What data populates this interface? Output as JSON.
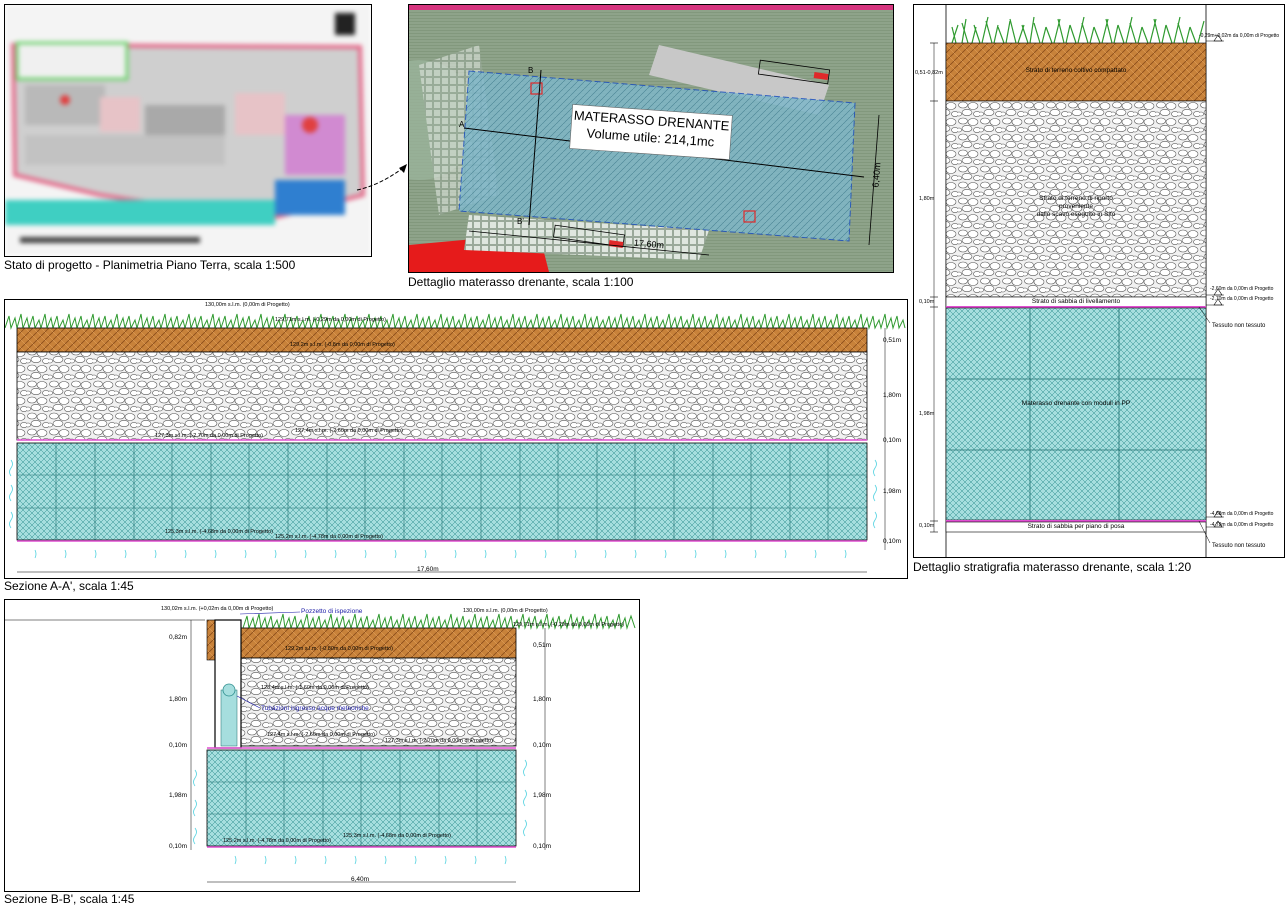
{
  "plan": {
    "caption": "Stato di progetto - Planimetria Piano Terra, scala 1:500"
  },
  "detail": {
    "caption": "Dettaglio materasso drenante, scala 1:100",
    "title_line1": "MATERASSO DRENANTE",
    "title_line2": "Volume utile: 214,1mc",
    "marker_a": "A",
    "marker_b_top": "B",
    "marker_b_bottom": "B'",
    "dim_length": "17,60m",
    "dim_width": "6,40m"
  },
  "stratigraphy": {
    "caption": "Dettaglio stratigrafia materasso drenante, scala 1:20",
    "layers": {
      "topsoil": "Strato di terreno coltivo compattato",
      "fill_line1": "Strato di terreno di riporto",
      "fill_line2": "proveniente",
      "fill_line3": "dallo scavo eseguito in Sito",
      "sand_top": "Strato di sabbia di livellamento",
      "mattress": "Materasso drenante con moduli in PP",
      "sand_bottom": "Strato di sabbia per piano di posa"
    },
    "fabric_top": "Tessuto non tessuto",
    "fabric_bottom": "Tessuto non tessuto",
    "thickness": [
      "0,51-0,82m",
      "1,80m",
      "0,10m",
      "1,98m",
      "0,10m"
    ],
    "levels": [
      "-0,29m+0,02m da 0,00m di Progetto",
      "-2,60m da 0,00m di Progetto",
      "-2,70m da 0,00m di Progetto",
      "-4,68m da 0,00m di Progetto",
      "-4,78m da 0,00m di Progetto"
    ]
  },
  "section_aa": {
    "caption": "Sezione A-A', scala 1:45",
    "levels": {
      "ground": "130,00m s.l.m. (0,00m di Progetto)",
      "grass": "129,71m s.l.m. (-0,29m da 0,00m di Progetto)",
      "topsoil_base": "129,2m s.l.m. (-0,8m da 0,00m di Progetto)",
      "fill_base": "127,4m s.l.m. (-2,60m da 0,00m di Progetto)",
      "sand_base": "127,3m s.l.m. (-2,70m da 0,00m di Progetto)",
      "mattress_base": "125,3m s.l.m. (-4,68m da 0,00m di Progetto)",
      "bottom": "125,2m s.l.m. (-4,78m da 0,00m di Progetto)"
    },
    "thickness": [
      "0,51m",
      "1,80m",
      "0,10m",
      "1,98m",
      "0,10m"
    ],
    "dim_length": "17,60m"
  },
  "section_bb": {
    "caption": "Sezione B-B', scala 1:45",
    "inspection_well": "Pozzetto di ispezione",
    "inlet_pipe": "Tubazioni ingresso acque meteoriche",
    "levels": {
      "well_top": "130,02m s.l.m. (+0,02m da 0,00m di Progetto)",
      "ground": "130,00m s.l.m. (0,00m di Progetto)",
      "grass": "129,71m s.l.m. (-0,29m da 0,00m di Progetto)",
      "topsoil_base": "129,2m s.l.m. (-0,80m da 0,00m di Progetto)",
      "pipe": "128,4m s.l.m. (-1,60m da 0,00m di Progetto)",
      "fill_base": "127,4m s.l.m. (-2,60m da 0,00m di Progetto)",
      "sand_base": "127,3m s.l.m. (-2,70m da 0,00m di Progetto)",
      "bottom": "125,2m s.l.m. (-4,78m da 0,00m di Progetto)",
      "mattress_base": "125,3m s.l.m. (-4,68m da 0,00m di Progetto)"
    },
    "thickness_left": [
      "0,82m",
      "1,80m",
      "0,10m",
      "1,98m",
      "0,10m"
    ],
    "thickness_right": [
      "0,51m",
      "1,80m",
      "0,10m",
      "1,98m",
      "0,10m"
    ],
    "dim_width": "6,40m"
  },
  "colors": {
    "topsoil": "#c8823a",
    "gravel": "#ececec",
    "mattress": "#9fd6d6",
    "grid": "#2f8f8f",
    "sand": "#e14fd2",
    "grass": "#2f9a2f",
    "marker": "#e0292a"
  }
}
